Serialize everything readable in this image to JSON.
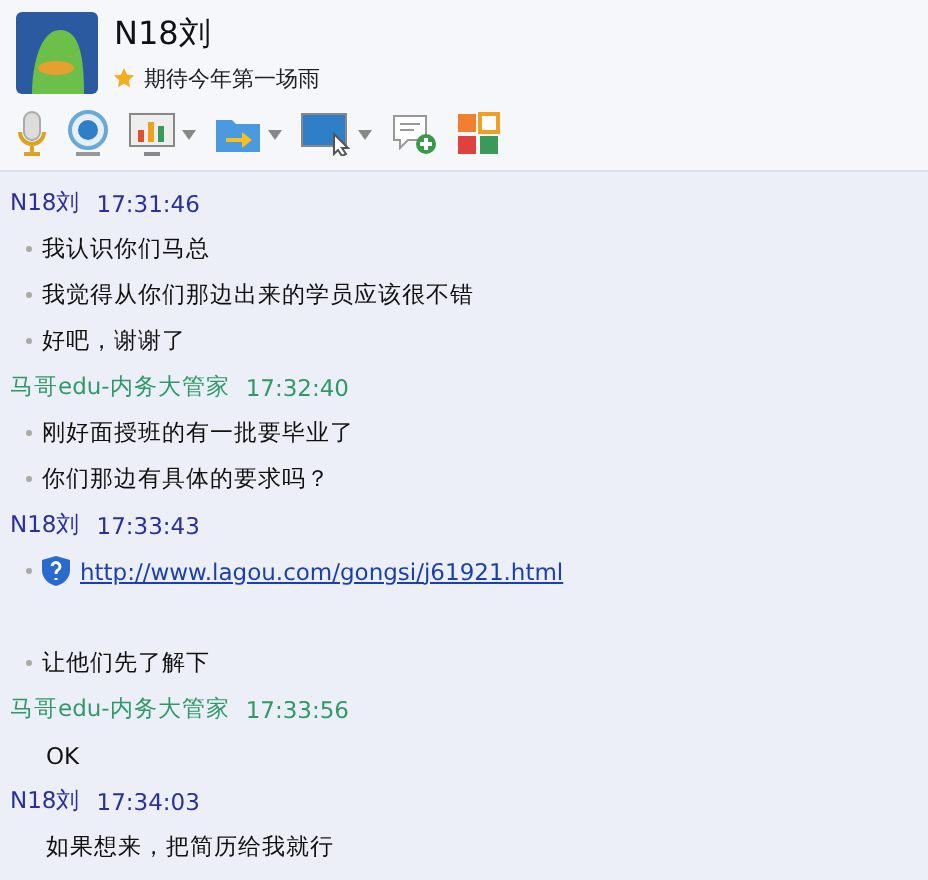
{
  "contact": {
    "name": "N18刘",
    "status": "期待今年第一场雨"
  },
  "toolbar": [
    {
      "kind": "mic",
      "dropdown": false
    },
    {
      "kind": "camera",
      "dropdown": false
    },
    {
      "kind": "screen",
      "dropdown": true
    },
    {
      "kind": "folder",
      "dropdown": true
    },
    {
      "kind": "remote",
      "dropdown": true
    },
    {
      "kind": "message",
      "dropdown": false
    },
    {
      "kind": "apps",
      "dropdown": false
    }
  ],
  "messages": [
    {
      "sender": "N18刘",
      "time": "17:31:46",
      "color": "#2b2f9c",
      "lines": [
        {
          "kind": "text",
          "text": "我认识你们马总",
          "bullet": true
        },
        {
          "kind": "text",
          "text": "我觉得从你们那边出来的学员应该很不错",
          "bullet": true
        },
        {
          "kind": "text",
          "text": "好吧，谢谢了",
          "bullet": true
        }
      ]
    },
    {
      "sender": "马哥edu-内务大管家",
      "time": "17:32:40",
      "color": "#2f9a68",
      "lines": [
        {
          "kind": "text",
          "text": "刚好面授班的有一批要毕业了",
          "bullet": true
        },
        {
          "kind": "text",
          "text": "你们那边有具体的要求吗？",
          "bullet": true
        }
      ]
    },
    {
      "sender": "N18刘",
      "time": "17:33:43",
      "color": "#2b2f9c",
      "lines": [
        {
          "kind": "link",
          "text": "http://www.lagou.com/gongsi/j61921.html",
          "bullet": true
        },
        {
          "kind": "blank",
          "bullet": false
        },
        {
          "kind": "text",
          "text": "让他们先了解下",
          "bullet": true
        }
      ]
    },
    {
      "sender": "马哥edu-内务大管家",
      "time": "17:33:56",
      "color": "#2f9a68",
      "lines": [
        {
          "kind": "text",
          "text": "OK",
          "bullet": false
        }
      ]
    },
    {
      "sender": "N18刘",
      "time": "17:34:03",
      "color": "#2b2f9c",
      "lines": [
        {
          "kind": "text",
          "text": "如果想来，把简历给我就行",
          "bullet": false
        }
      ]
    }
  ]
}
